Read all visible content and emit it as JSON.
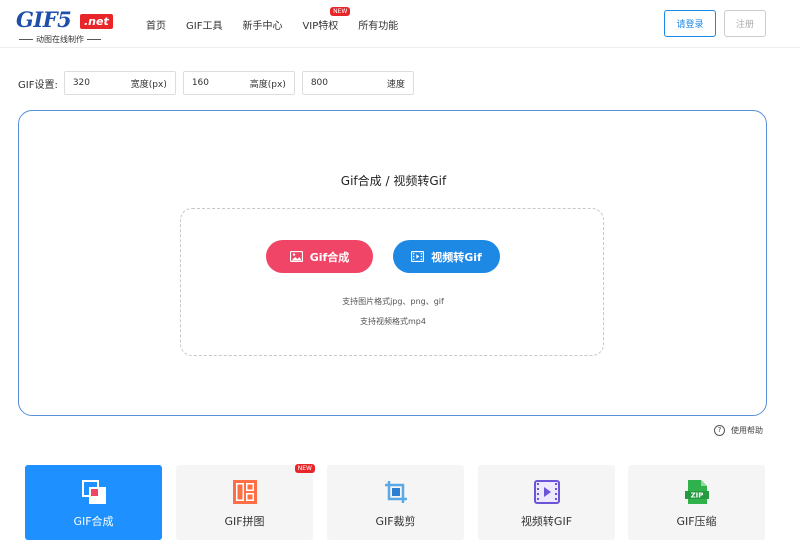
{
  "header": {
    "logo_main": "GIF5",
    "logo_net": ".net",
    "logo_sub": "动图在线制作",
    "nav": [
      {
        "label": "首页"
      },
      {
        "label": "GIF工具"
      },
      {
        "label": "新手中心"
      },
      {
        "label": "VIP特权",
        "badge": "NEW"
      },
      {
        "label": "所有功能"
      }
    ],
    "login_label": "请登录",
    "register_label": "注册"
  },
  "settings": {
    "label": "GIF设置:",
    "width_value": "320",
    "width_unit": "宽度(px)",
    "height_value": "160",
    "height_unit": "高度(px)",
    "speed_value": "800",
    "speed_unit": "速度"
  },
  "panel": {
    "title": "Gif合成 / 视频转Gif",
    "gif_button": "Gif合成",
    "video_button": "视频转Gif",
    "support_images": "支持图片格式jpg、png、gif",
    "support_video": "支持视频格式mp4"
  },
  "help_label": "使用帮助",
  "tools": [
    {
      "label": "GIF合成",
      "icon": "gif-compose-icon",
      "active": true
    },
    {
      "label": "GIF拼图",
      "icon": "gif-puzzle-icon",
      "badge": "NEW"
    },
    {
      "label": "GIF裁剪",
      "icon": "crop-icon"
    },
    {
      "label": "视频转GIF",
      "icon": "video-to-gif-icon"
    },
    {
      "label": "GIF压缩",
      "icon": "zip-icon",
      "icon_text": "ZIP"
    }
  ],
  "colors": {
    "brand_blue": "#1e88e5",
    "pink": "#f04566",
    "active_tile": "#1e90ff",
    "badge_red": "#e8262a"
  }
}
